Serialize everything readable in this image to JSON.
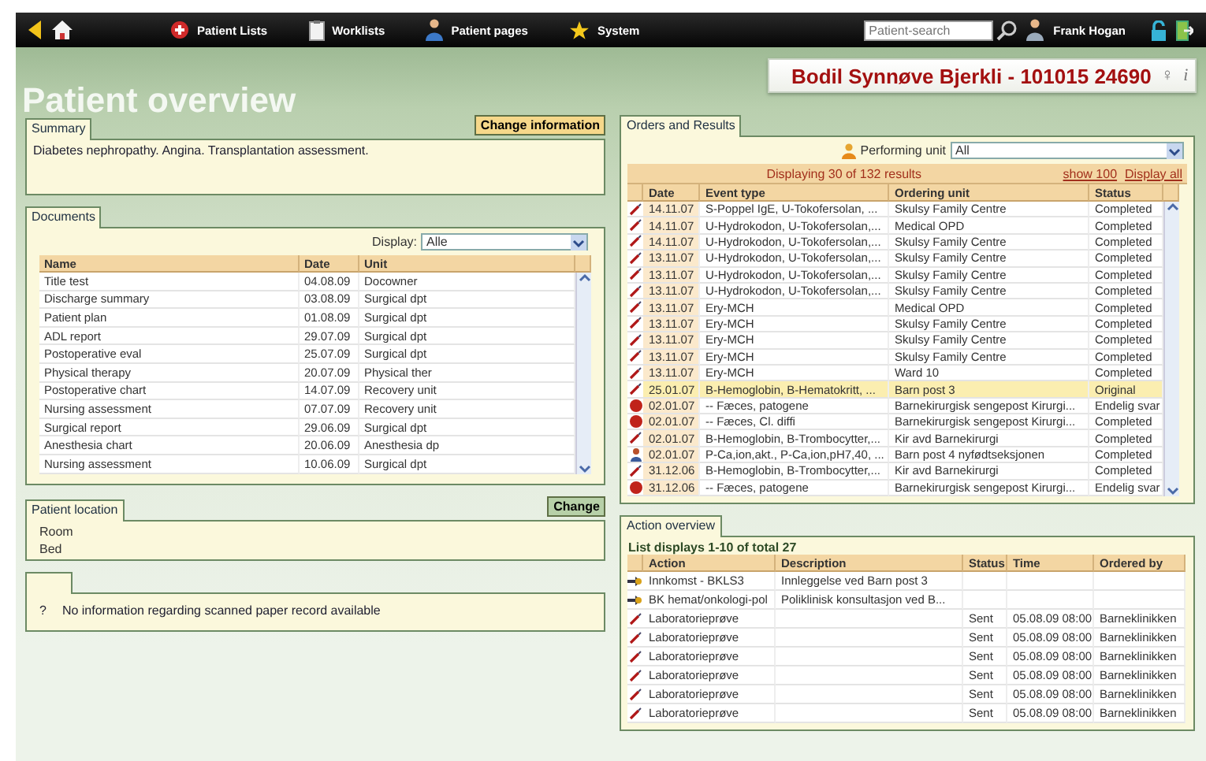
{
  "nav": {
    "items": [
      {
        "label": "Patient Lists",
        "kind": "lists"
      },
      {
        "label": "Worklists",
        "kind": "work"
      },
      {
        "label": "Patient pages",
        "kind": "pages"
      },
      {
        "label": "System",
        "kind": "system"
      }
    ],
    "search": {
      "placeholder": "Patient-search"
    },
    "user": "Frank Hogan"
  },
  "page_title": "Patient overview",
  "patient": {
    "name": "Bodil Synnøve Bjerkli - 101015 24690",
    "gender": "♀",
    "info": "i"
  },
  "summary": {
    "tab": "Summary",
    "button": "Change information",
    "text": "Diabetes nephropathy. Angina. Transplantation assessment."
  },
  "documents": {
    "tab": "Documents",
    "display_label": "Display:",
    "display_value": "Alle",
    "columns": [
      "Name",
      "Date",
      "Unit"
    ],
    "rows": [
      [
        "Title test",
        "04.08.09",
        "Docowner"
      ],
      [
        "Discharge summary",
        "03.08.09",
        "Surgical dpt"
      ],
      [
        "Patient plan",
        "01.08.09",
        "Surgical dpt"
      ],
      [
        "ADL report",
        "29.07.09",
        "Surgical dpt"
      ],
      [
        "Postoperative eval",
        "25.07.09",
        "Surgical dpt"
      ],
      [
        "Physical therapy",
        "20.07.09",
        "Physical ther"
      ],
      [
        "Postoperative chart",
        "14.07.09",
        "Recovery unit"
      ],
      [
        "Nursing assessment",
        "07.07.09",
        "Recovery unit"
      ],
      [
        "Surgical report",
        "29.06.09",
        "Surgical dpt"
      ],
      [
        "Anesthesia chart",
        "20.06.09",
        "Anesthesia dp"
      ],
      [
        "Nursing assessment",
        "10.06.09",
        "Surgical dpt"
      ]
    ]
  },
  "location": {
    "tab": "Patient location",
    "button": "Change",
    "rows": [
      "Room",
      "Bed"
    ]
  },
  "scanned": {
    "mark": "?",
    "message": "No information regarding scanned paper record available"
  },
  "orders": {
    "tab": "Orders and Results",
    "unit_label": "Performing unit",
    "unit_value": "All",
    "count": "Displaying 30 of 132 results",
    "links": [
      "show 100",
      "Display all"
    ],
    "columns": [
      "Date",
      "Event type",
      "Ordering unit",
      "Status"
    ],
    "rows": [
      {
        "kind": "pen",
        "selected": false,
        "cells": [
          "14.11.07",
          "S-Poppel IgE, U-Tokofersolan, ...",
          "Skulsy Family Centre",
          "Completed"
        ]
      },
      {
        "kind": "pen",
        "selected": false,
        "cells": [
          "14.11.07",
          "U-Hydrokodon, U-Tokofersolan,...",
          "Medical OPD",
          "Completed"
        ]
      },
      {
        "kind": "pen",
        "selected": false,
        "cells": [
          "14.11.07",
          "U-Hydrokodon, U-Tokofersolan,...",
          "Skulsy Family Centre",
          "Completed"
        ]
      },
      {
        "kind": "pen",
        "selected": false,
        "cells": [
          "13.11.07",
          "U-Hydrokodon, U-Tokofersolan,...",
          "Skulsy Family Centre",
          "Completed"
        ]
      },
      {
        "kind": "pen",
        "selected": false,
        "cells": [
          "13.11.07",
          "U-Hydrokodon, U-Tokofersolan,...",
          "Skulsy Family Centre",
          "Completed"
        ]
      },
      {
        "kind": "pen",
        "selected": false,
        "cells": [
          "13.11.07",
          "U-Hydrokodon, U-Tokofersolan,...",
          "Skulsy Family Centre",
          "Completed"
        ]
      },
      {
        "kind": "pen",
        "selected": false,
        "cells": [
          "13.11.07",
          "Ery-MCH",
          "Medical OPD",
          "Completed"
        ]
      },
      {
        "kind": "pen",
        "selected": false,
        "cells": [
          "13.11.07",
          "Ery-MCH",
          "Skulsy Family Centre",
          "Completed"
        ]
      },
      {
        "kind": "pen",
        "selected": false,
        "cells": [
          "13.11.07",
          "Ery-MCH",
          "Skulsy Family Centre",
          "Completed"
        ]
      },
      {
        "kind": "pen",
        "selected": false,
        "cells": [
          "13.11.07",
          "Ery-MCH",
          "Skulsy Family Centre",
          "Completed"
        ]
      },
      {
        "kind": "pen",
        "selected": false,
        "cells": [
          "13.11.07",
          "Ery-MCH",
          "Ward 10",
          "Completed"
        ]
      },
      {
        "kind": "pen",
        "selected": true,
        "cells": [
          "25.01.07",
          "B-Hemoglobin, B-Hematokritt, ...",
          "Barn post 3",
          "Original"
        ]
      },
      {
        "kind": "dot",
        "selected": false,
        "cells": [
          "02.01.07",
          "-- Fæces, patogene",
          "Barnekirurgisk sengepost Kirurgi...",
          "Endelig svar"
        ]
      },
      {
        "kind": "dot",
        "selected": false,
        "cells": [
          "02.01.07",
          "-- Fæces, Cl. diffi",
          "Barnekirurgisk sengepost Kirurgi...",
          "Completed"
        ]
      },
      {
        "kind": "pen",
        "selected": false,
        "cells": [
          "02.01.07",
          "B-Hemoglobin, B-Trombocytter,...",
          "Kir avd Barnekirurgi",
          "Completed"
        ]
      },
      {
        "kind": "person",
        "selected": false,
        "cells": [
          "02.01.07",
          "P-Ca,ion,akt., P-Ca,ion,pH7,40, ...",
          "Barn post 4 nyfødtseksjonen",
          "Completed"
        ]
      },
      {
        "kind": "pen",
        "selected": false,
        "cells": [
          "31.12.06",
          "B-Hemoglobin, B-Trombocytter,...",
          "Kir avd Barnekirurgi",
          "Completed"
        ]
      },
      {
        "kind": "dot",
        "selected": false,
        "cells": [
          "31.12.06",
          "-- Fæces, patogene",
          "Barnekirurgisk sengepost Kirurgi...",
          "Endelig svar"
        ]
      }
    ]
  },
  "actions": {
    "tab": "Action overview",
    "count": "List displays 1-10 of total 27",
    "columns": [
      "Action",
      "Description",
      "Status",
      "Time",
      "Ordered by"
    ],
    "rows": [
      {
        "kind": "arrow",
        "cells": [
          "Innkomst - BKLS3",
          "Innleggelse ved Barn post 3",
          "",
          "",
          ""
        ]
      },
      {
        "kind": "arrow",
        "cells": [
          "BK hemat/onkologi-pol",
          "Poliklinisk konsultasjon ved B...",
          "",
          "",
          ""
        ]
      },
      {
        "kind": "pen",
        "cells": [
          "Laboratorieprøve",
          "",
          "Sent",
          "05.08.09 08:00",
          "Barneklinikken"
        ]
      },
      {
        "kind": "pen",
        "cells": [
          "Laboratorieprøve",
          "",
          "Sent",
          "05.08.09 08:00",
          "Barneklinikken"
        ]
      },
      {
        "kind": "pen",
        "cells": [
          "Laboratorieprøve",
          "",
          "Sent",
          "05.08.09 08:00",
          "Barneklinikken"
        ]
      },
      {
        "kind": "pen",
        "cells": [
          "Laboratorieprøve",
          "",
          "Sent",
          "05.08.09 08:00",
          "Barneklinikken"
        ]
      },
      {
        "kind": "pen",
        "cells": [
          "Laboratorieprøve",
          "",
          "Sent",
          "05.08.09 08:00",
          "Barneklinikken"
        ]
      },
      {
        "kind": "pen",
        "cells": [
          "Laboratorieprøve",
          "",
          "Sent",
          "05.08.09 08:00",
          "Barneklinikken"
        ]
      }
    ]
  }
}
